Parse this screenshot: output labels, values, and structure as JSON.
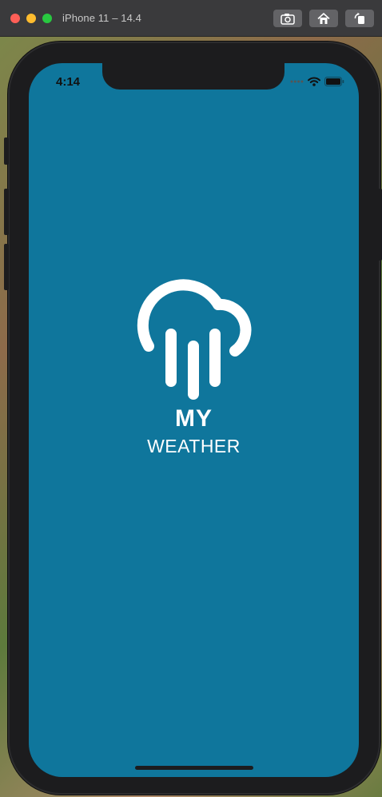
{
  "simulator": {
    "title": "iPhone 11 – 14.4",
    "buttons": {
      "screenshot_icon": "camera-icon",
      "home_icon": "home-icon",
      "rotate_icon": "rotate-icon"
    }
  },
  "status_bar": {
    "time": "4:14",
    "icons": [
      "cellular-icon",
      "wifi-icon",
      "battery-icon"
    ]
  },
  "splash": {
    "logo_icon": "cloud-rain-icon",
    "title_line1": "MY",
    "title_line2": "WEATHER"
  },
  "colors": {
    "screen_background": "#0f769c",
    "logo_color": "#ffffff",
    "device_frame": "#1c1c1e"
  }
}
